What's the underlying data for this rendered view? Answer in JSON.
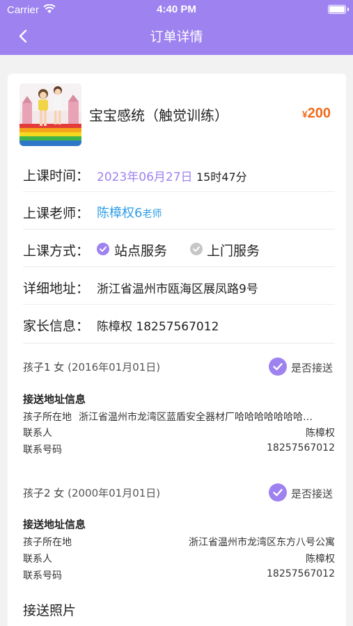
{
  "status_bar": {
    "carrier": "Carrier",
    "time": "4:40 PM"
  },
  "nav": {
    "title": "订单详情"
  },
  "course": {
    "name": "宝宝感统（触觉训练）",
    "price": "200",
    "currency": "¥"
  },
  "fields": {
    "time_label": "上课时间：",
    "time_date": "2023年06月27日",
    "time_clock": "15时47分",
    "teacher_label": "上课老师：",
    "teacher_name": "陈樟权6",
    "teacher_suffix": "老师",
    "mode_label": "上课方式：",
    "mode_option1": "站点服务",
    "mode_option2": "上门服务",
    "address_label": "详细地址：",
    "address_value": "浙江省温州市瓯海区展凤路9号",
    "parent_label": "家长信息：",
    "parent_value": "陈樟权 18257567012"
  },
  "children": [
    {
      "title": "孩子1 女",
      "birth": "(2016年01月01日)",
      "pickup_label": "是否接送",
      "section_title": "接送地址信息",
      "location_label": "孩子所在地",
      "location_value": "浙江省温州市龙湾区蓝盾安全器材厂哈哈哈哈哈哈哈…",
      "contact_label": "联系人",
      "contact_value": "陈樟权",
      "phone_label": "联系号码",
      "phone_value": "18257567012"
    },
    {
      "title": "孩子2 女",
      "birth": "(2000年01月01日)",
      "pickup_label": "是否接送",
      "section_title": "接送地址信息",
      "location_label": "孩子所在地",
      "location_value": "浙江省温州市龙湾区东方八号公寓",
      "contact_label": "联系人",
      "contact_value": "陈樟权",
      "phone_label": "联系号码",
      "phone_value": "18257567012"
    }
  ],
  "photos": {
    "title": "接送照片"
  },
  "colors": {
    "accent": "#9d82f0",
    "price": "#f06a1b",
    "link": "#2e9de6"
  }
}
